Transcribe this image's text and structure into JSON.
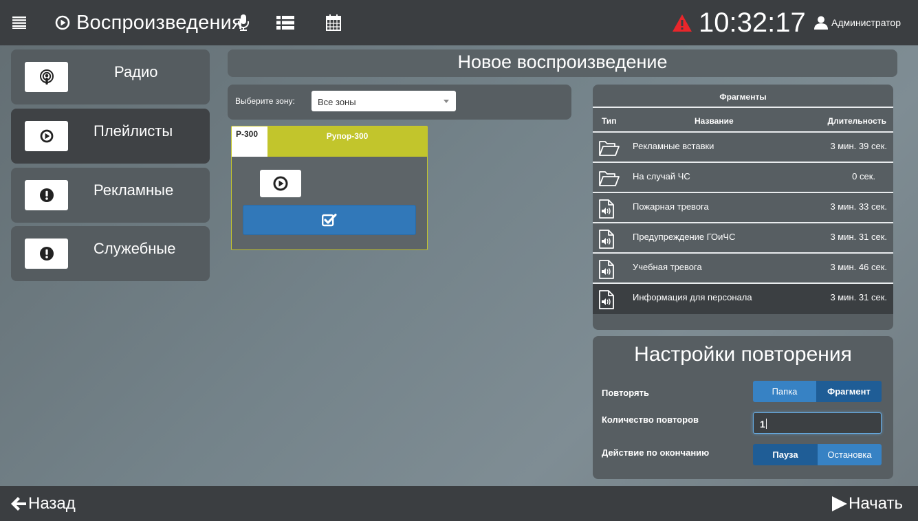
{
  "topbar": {
    "title": "Воспроизведения",
    "clock": "10:32:17",
    "user": "Администратор",
    "icons": [
      "menu-icon",
      "play-circle-icon",
      "microphone-icon",
      "list-icon",
      "calendar-icon",
      "warning-icon",
      "user-icon"
    ],
    "alert_color": "#e8262b"
  },
  "nav": {
    "items": [
      {
        "label": "Радио",
        "icon": "podcast-icon"
      },
      {
        "label": "Плейлисты",
        "icon": "play-circle-icon",
        "active": true
      },
      {
        "label": "Рекламные",
        "icon": "exclamation-icon"
      },
      {
        "label": "Служебные",
        "icon": "exclamation-icon"
      }
    ]
  },
  "main": {
    "header": "Новое воспроизведение",
    "zone": {
      "label": "Выберите зону:",
      "selected": "Все зоны"
    },
    "zone_card": {
      "code": "Р-300",
      "name": "Рупор-300",
      "accent_color": "#c2c52c"
    }
  },
  "fragments": {
    "title": "Фрагменты",
    "columns": [
      "Тип",
      "Название",
      "Длительность"
    ],
    "rows": [
      {
        "type": "folder-icon",
        "name": "Рекламные вставки",
        "duration": "3 мин. 39 сек."
      },
      {
        "type": "folder-icon",
        "name": "На случай ЧС",
        "duration": "0 сек."
      },
      {
        "type": "audio-file-icon",
        "name": "Пожарная тревога",
        "duration": "3 мин. 33 сек."
      },
      {
        "type": "audio-file-icon",
        "name": "Предупреждение ГОиЧС",
        "duration": "3 мин. 31 сек."
      },
      {
        "type": "audio-file-icon",
        "name": "Учебная тревога",
        "duration": "3 мин. 46 сек."
      },
      {
        "type": "audio-file-icon",
        "name": "Информация для персонала",
        "duration": "3 мин. 31 сек.",
        "selected": true
      }
    ]
  },
  "repeat": {
    "title": "Настройки повторения",
    "repeat_label": "Повторять",
    "repeat_options": [
      "Папка",
      "Фрагмент"
    ],
    "repeat_selected": "Фрагмент",
    "count_label": "Количество повторов",
    "count_value": "1",
    "end_label": "Действие по окончанию",
    "end_options": [
      "Пауза",
      "Остановка"
    ],
    "end_selected": "Пауза"
  },
  "bottom": {
    "back": "Назад",
    "start": "Начать"
  }
}
